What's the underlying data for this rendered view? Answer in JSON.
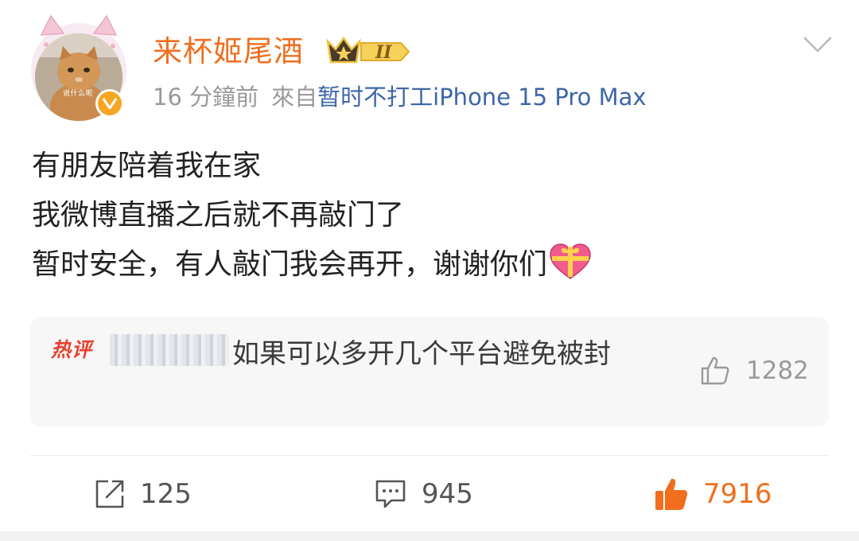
{
  "post": {
    "username": "来杯姬尾酒",
    "member_level": "II",
    "avatar_caption": "说什么呢",
    "time": "16 分鐘前",
    "source_prefix": "來自",
    "source": "暂时不打工iPhone 15 Pro Max",
    "lines": [
      "有朋友陪着我在家",
      "我微博直播之后就不再敲门了",
      "暂时安全，有人敲门我会再开，谢谢你们"
    ],
    "emoji": "gift-heart-icon"
  },
  "hot_comment": {
    "tag": "热评",
    "text": "如果可以多开几个平台避免被封",
    "likes": "1282"
  },
  "actions": {
    "reposts": "125",
    "comments": "945",
    "likes": "7916"
  },
  "colors": {
    "username": "#f06e1e",
    "source_link": "#3d66a8",
    "hot_tag": "#e8402f",
    "liked": "#f06e1e",
    "muted": "#9a9a9a"
  }
}
